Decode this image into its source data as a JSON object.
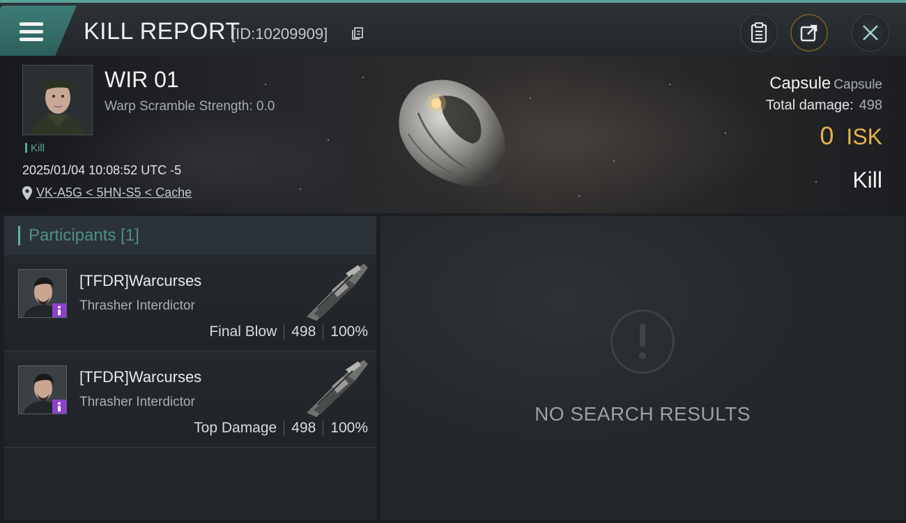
{
  "header": {
    "title": "KILL REPORT",
    "report_id": "[ID:10209909]"
  },
  "victim": {
    "name": "WIR 01",
    "warp_scramble": "Warp Scramble Strength: 0.0",
    "tag": "Kill",
    "datetime": "2025/01/04 10:08:52 UTC -5",
    "location": "VK-A5G < 5HN-S5 < Cache",
    "ship_name": "Capsule",
    "ship_class": "Capsule",
    "total_damage_label": "Total damage:",
    "total_damage_value": "498",
    "isk_value": "0",
    "isk_unit": "ISK",
    "outcome": "Kill"
  },
  "participants_panel": {
    "title": "Participants [1]",
    "items": [
      {
        "name": "[TFDR]Warcurses",
        "ship": "Thrasher Interdictor",
        "role": "Final Blow",
        "damage": "498",
        "percent": "100%"
      },
      {
        "name": "[TFDR]Warcurses",
        "ship": "Thrasher Interdictor",
        "role": "Top Damage",
        "damage": "498",
        "percent": "100%"
      }
    ]
  },
  "results": {
    "empty_text": "NO SEARCH RESULTS"
  },
  "icons": [
    "menu-icon",
    "copy-icon",
    "clipboard-icon",
    "share-icon",
    "close-icon",
    "location-pin-icon",
    "alert-icon",
    "corp-badge-icon"
  ],
  "colors": {
    "accent_teal": "#5aa49a",
    "isk_gold": "#e3b24a",
    "badge_purple": "#8d3fd0"
  }
}
